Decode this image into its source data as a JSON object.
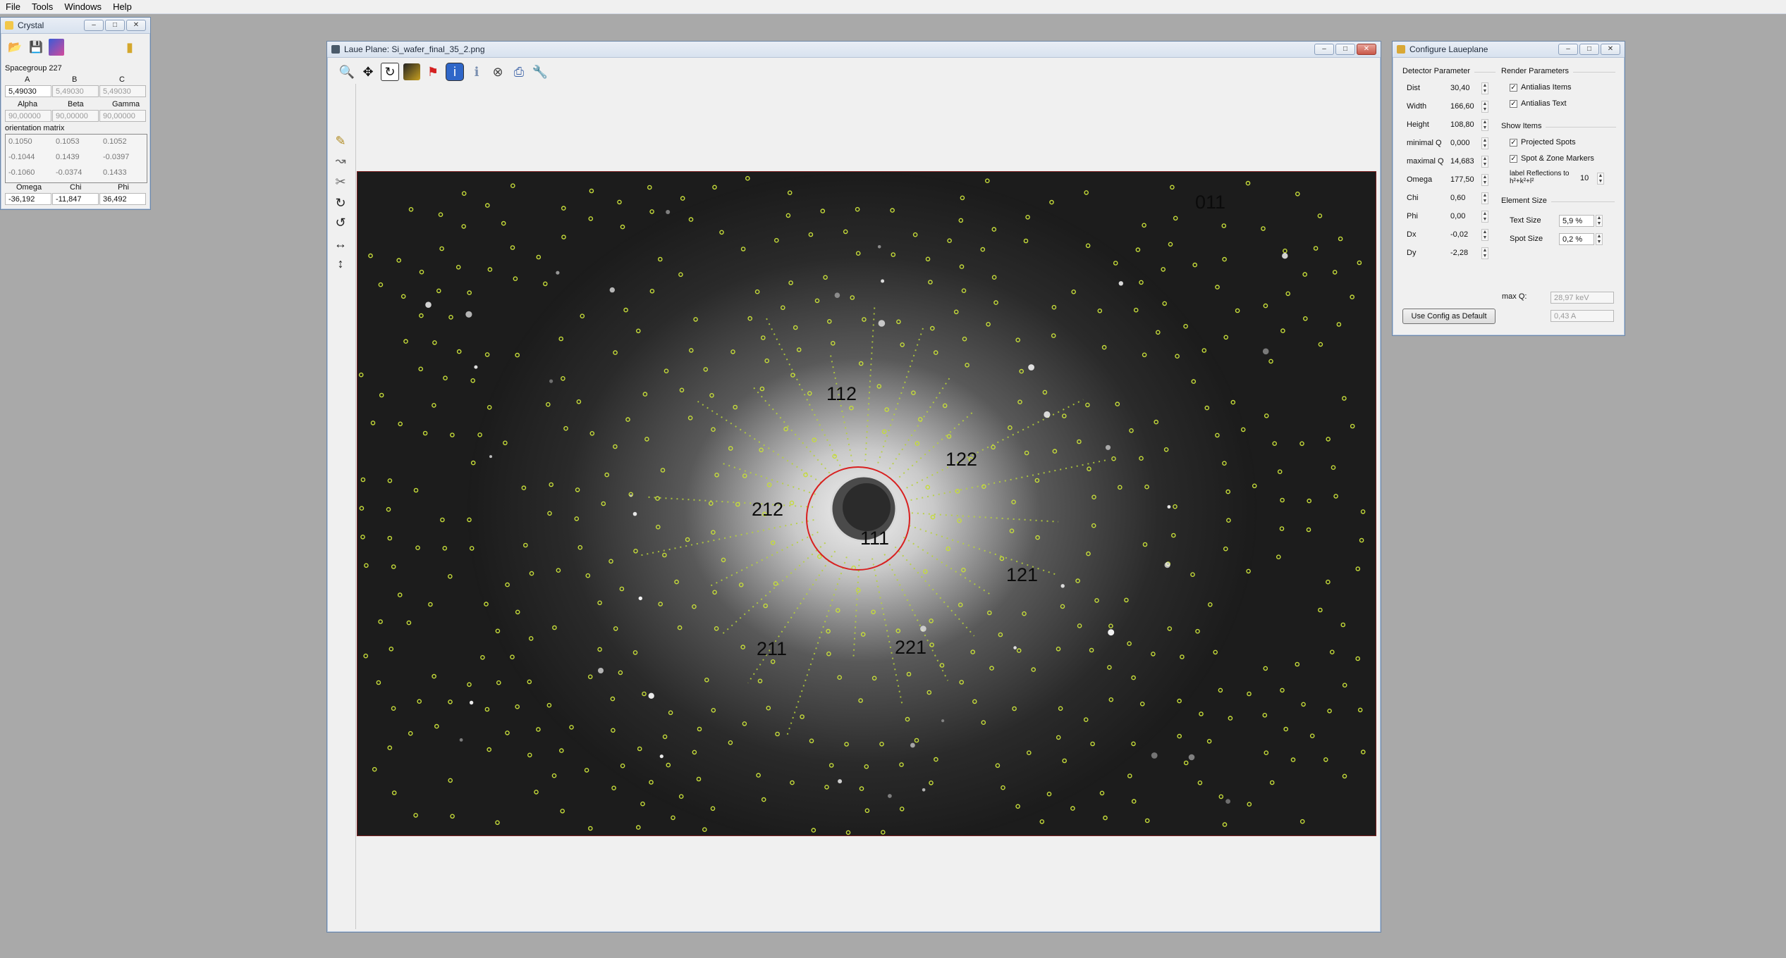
{
  "menubar": {
    "items": [
      "File",
      "Tools",
      "Windows",
      "Help"
    ]
  },
  "crystal": {
    "title": "Crystal",
    "spacegroup_label": "Spacegroup 227",
    "abc_headers": [
      "A",
      "B",
      "C"
    ],
    "abc_values": [
      "5,49030",
      "5,49030",
      "5,49030"
    ],
    "angle_headers": [
      "Alpha",
      "Beta",
      "Gamma"
    ],
    "angle_values": [
      "90,00000",
      "90,00000",
      "90,00000"
    ],
    "orientation_label": "orientation matrix",
    "matrix": [
      [
        "0.1050",
        "0.1053",
        "0.1052"
      ],
      [
        "-0.1044",
        "0.1439",
        "-0.0397"
      ],
      [
        "-0.1060",
        "-0.0374",
        "0.1433"
      ]
    ],
    "euler_headers": [
      "Omega",
      "Chi",
      "Phi"
    ],
    "euler_values": [
      "-36,192",
      "-11,847",
      "36,492"
    ]
  },
  "laue": {
    "title": "Laue Plane: Si_wafer_final_35_2.png",
    "toolbar_icons": [
      "zoom-icon",
      "move-icon",
      "rotate-icon",
      "image-icon",
      "flag-icon",
      "info-icon",
      "info2-icon",
      "stop-icon",
      "print-icon",
      "wrench-icon"
    ],
    "labels": {
      "l011": "011",
      "l112": "112",
      "l122": "122",
      "l212": "212",
      "l111": "111",
      "l121": "121",
      "l211": "211",
      "l221": "221"
    }
  },
  "config": {
    "title": "Configure Laueplane",
    "detector_group": "Detector Parameter",
    "render_group": "Render Parameters",
    "params": [
      {
        "label": "Dist",
        "value": "30,40"
      },
      {
        "label": "Width",
        "value": "166,60"
      },
      {
        "label": "Height",
        "value": "108,80"
      },
      {
        "label": "minimal Q",
        "value": "0,000"
      },
      {
        "label": "maximal Q",
        "value": "14,683"
      },
      {
        "label": "Omega",
        "value": "177,50"
      },
      {
        "label": "Chi",
        "value": "0,60"
      },
      {
        "label": "Phi",
        "value": "0,00"
      },
      {
        "label": "Dx",
        "value": "-0,02"
      },
      {
        "label": "Dy",
        "value": "-2,28"
      }
    ],
    "antialias_items": "Antialias Items",
    "antialias_text": "Antialias Text",
    "show_items_group": "Show Items",
    "projected_spots": "Projected Spots",
    "spot_zone_markers": "Spot & Zone Markers",
    "label_reflections_1": "label Reflections to",
    "label_reflections_2": "h²+k²+l²",
    "label_reflections_value": "10",
    "element_size_group": "Element Size",
    "text_size_label": "Text Size",
    "text_size_value": "5,9 %",
    "spot_size_label": "Spot Size",
    "spot_size_value": "0,2 %",
    "maxq_label": "max Q:",
    "maxq_kev": "28,97 keV",
    "maxq_a": "0,43 A",
    "default_button": "Use Config as Default"
  }
}
